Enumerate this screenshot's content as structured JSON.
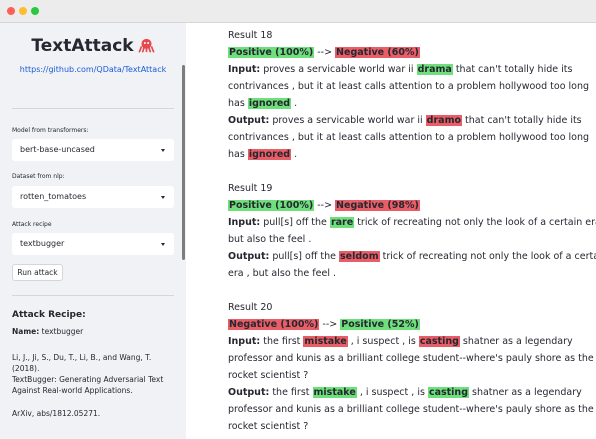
{
  "sidebar": {
    "title": "TextAttack",
    "link": "https://github.com/QData/TextAttack",
    "model_label": "Model from transformers:",
    "model_value": "bert-base-uncased",
    "dataset_label": "Dataset from nlp:",
    "dataset_value": "rotten_tomatoes",
    "recipe_label": "Attack recipe",
    "recipe_value": "textbugger",
    "run_button": "Run attack",
    "recipe_heading": "Attack Recipe:",
    "name_label": "Name:",
    "name_value": "textbugger",
    "citation_l1": "Li, J., Ji, S., Du, T., Li, B., and Wang, T.",
    "citation_l2": "(2018).",
    "citation_l3": "TextBugger: Generating Adversarial Text",
    "citation_l4": "Against Real-world Applications.",
    "citation_l5": "ArXiv, abs/1812.05271."
  },
  "results": {
    "r18": {
      "title": "Result 18",
      "from": "Positive (100%)",
      "arrow": " --> ",
      "to": "Negative (60%)",
      "input_label": "Input:",
      "in_a": " proves a servicable world war ii ",
      "in_w1": "drama",
      "in_b": " that can't totally hide its",
      "in_c": "contrivances , but it at least calls attention to a problem hollywood too long",
      "in_d": "has ",
      "in_w2": "ignored",
      "in_e": " .",
      "output_label": "Output:",
      "out_a": " proves a servicable world war ii ",
      "out_w1": "dramo",
      "out_b": " that can't totally hide its",
      "out_c": "contrivances , but it at least calls attention to a problem hollywood too long",
      "out_d": "has ",
      "out_w2": "ignored",
      "out_e": " ."
    },
    "r19": {
      "title": "Result 19",
      "from": "Positive (100%)",
      "arrow": " --> ",
      "to": "Negative (98%)",
      "input_label": "Input:",
      "in_a": " pull[s] off the ",
      "in_w1": "rare",
      "in_b": " trick of recreating not only the look of a certain era ,",
      "in_c": "but also the feel .",
      "output_label": "Output:",
      "out_a": " pull[s] off the ",
      "out_w1": "seldom",
      "out_b": " trick of recreating not only the look of a certain",
      "out_c": "era , but also the feel ."
    },
    "r20": {
      "title": "Result 20",
      "from": "Negative (100%)",
      "arrow": " --> ",
      "to": "Positive (52%)",
      "input_label": "Input:",
      "in_a": " the first ",
      "in_w1": "mistake",
      "in_b": " , i suspect , is ",
      "in_w2": "casting",
      "in_c": " shatner as a legendary",
      "in_d": "professor and kunis as a brilliant college student--where's pauly shore as the",
      "in_e": "rocket scientist ?",
      "output_label": "Output:",
      "out_a": " the first ",
      "out_w1": "mistake",
      "out_b": " , i suspect , is ",
      "out_w2": "casting",
      "out_c": " shatner as a legendary",
      "out_d": "professor and kunis as a brilliant college student--where's pauly shore as the",
      "out_e": "rocket scientist ?"
    }
  },
  "colors": {
    "positive_highlight": "#6ee07b",
    "negative_highlight": "#e95d66",
    "sidebar_bg": "#f0f2f6",
    "link": "#1a5bd6"
  },
  "icons": {
    "logo": "octopus-icon",
    "select_arrow": "chevron-down-icon"
  }
}
